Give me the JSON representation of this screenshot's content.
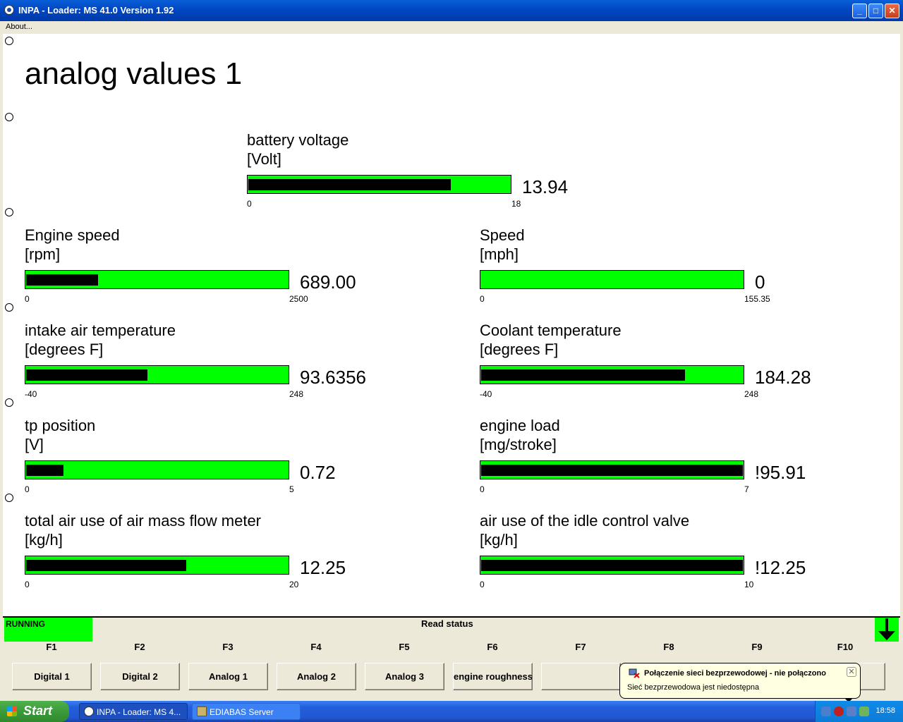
{
  "window": {
    "title": "INPA - Loader:  MS 41.0 Version 1.92",
    "minimize": "_",
    "maximize": "□",
    "close": "✕"
  },
  "menu": {
    "about": "About..."
  },
  "screen": {
    "heading": "analog values 1"
  },
  "gauges": [
    {
      "name": "battery voltage",
      "unit": "[Volt]",
      "value": "13.94",
      "min": "0",
      "max": "18",
      "fill_fraction": 0.774
    },
    {
      "name": "Engine speed",
      "unit": "[rpm]",
      "value": "689.00",
      "min": "0",
      "max": "2500",
      "fill_fraction": 0.276
    },
    {
      "name": "Speed",
      "unit": "[mph]",
      "value": "0",
      "min": "0",
      "max": "155.35",
      "fill_fraction": 0
    },
    {
      "name": "intake air temperature",
      "unit": "[degrees F]",
      "value": "93.6356",
      "min": "-40",
      "max": "248",
      "fill_fraction": 0.464
    },
    {
      "name": "Coolant temperature",
      "unit": "[degrees F]",
      "value": "184.28",
      "min": "-40",
      "max": "248",
      "fill_fraction": 0.779
    },
    {
      "name": "tp position",
      "unit": "[V]",
      "value": "0.72",
      "min": "0",
      "max": "5",
      "fill_fraction": 0.144
    },
    {
      "name": "engine load",
      "unit": "[mg/stroke]",
      "value": "!95.91",
      "min": "0",
      "max": "7",
      "fill_fraction": 1
    },
    {
      "name": "total air use of air mass flow meter",
      "unit": "[kg/h]",
      "value": "12.25",
      "min": "0",
      "max": "20",
      "fill_fraction": 0.613
    },
    {
      "name": "air use of the idle control valve",
      "unit": "[kg/h]",
      "value": "!12.25",
      "min": "0",
      "max": "10",
      "fill_fraction": 1
    }
  ],
  "status": {
    "state": "RUNNING",
    "label": "Read status",
    "state_color": "#00ff00"
  },
  "function_keys": [
    "F1",
    "F2",
    "F3",
    "F4",
    "F5",
    "F6",
    "F7",
    "F8",
    "F9",
    "F10"
  ],
  "function_buttons": [
    "Digital 1",
    "Digital 2",
    "Analog 1",
    "Analog 2",
    "Analog 3",
    "engine roughness",
    "",
    "",
    "",
    ""
  ],
  "taskbar": {
    "start": "Start",
    "tasks": [
      "INPA - Loader:  MS 4...",
      "EDIABAS Server"
    ],
    "clock": "18:58"
  },
  "balloon": {
    "title": "Połączenie sieci bezprzewodowej - nie połączono",
    "text": "Sieć bezprzewodowa jest niedostępna",
    "close": "✕"
  },
  "colors": {
    "bar_background": "#00ff00",
    "bar_fill": "#000000",
    "titlebar": "#0a5fd8"
  }
}
